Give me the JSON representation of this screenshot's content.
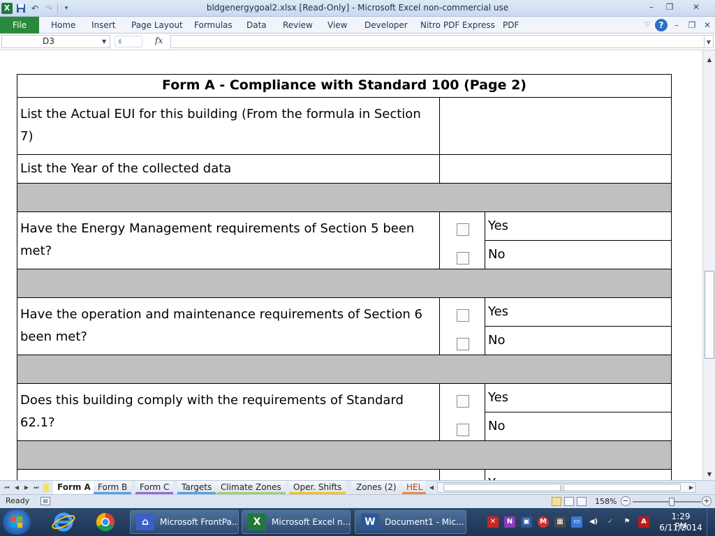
{
  "window": {
    "title": "bldgenergygoal2.xlsx  [Read-Only]  -  Microsoft Excel non-commercial use",
    "logo": "X",
    "controls": [
      "–",
      "❐",
      "✕"
    ]
  },
  "quick_access": {
    "icons": [
      "save-icon",
      "undo-icon",
      "redo-icon",
      "customize-icon"
    ]
  },
  "ribbon": {
    "file_tab": "File",
    "tabs": [
      "Home",
      "Insert",
      "Page Layout",
      "Formulas",
      "Data",
      "Review",
      "View",
      "Developer",
      "Nitro PDF Express",
      "PDF"
    ]
  },
  "formula_bar": {
    "name_box": "D3",
    "fx": "fx",
    "value": ""
  },
  "form": {
    "title": "Form A - Compliance with Standard 100  (Page 2)",
    "rows": [
      {
        "question": "List the Actual EUI for this building (From the formula in Section 7)"
      },
      {
        "question": "List the Year of the collected data"
      },
      {
        "question": "Have the Energy Management requirements of Section 5 been met?",
        "yes": "Yes",
        "no": "No"
      },
      {
        "question": "Have the operation and maintenance requirements of Section 6 been met?",
        "yes": "Yes",
        "no": "No"
      },
      {
        "question": "Does this building comply with the requirements of Standard 62.1?",
        "yes": "Yes",
        "no": "No"
      },
      {
        "yes": "Y"
      }
    ]
  },
  "sheet_tabs": [
    {
      "label": "Form A",
      "color": "#ffffff",
      "active": true
    },
    {
      "label": "Form B",
      "color": "#4fa3e8"
    },
    {
      "label": "Form C",
      "color": "#9b6ad6"
    },
    {
      "label": "Targets",
      "color": "#4fa3e8"
    },
    {
      "label": "Climate Zones",
      "color": "#a7cf6b"
    },
    {
      "label": "Oper. Shifts",
      "color": "#f5c518"
    },
    {
      "label": "Zones (2)",
      "color": "#e6e6e6"
    },
    {
      "label": "HEL",
      "color": "#f28a3c"
    }
  ],
  "status_bar": {
    "status": "Ready",
    "zoom": "158%",
    "zoom_out": "−",
    "zoom_in": "+"
  },
  "taskbar": {
    "apps": [
      {
        "label": "Microsoft FrontPa...",
        "icon": "frontpage-icon",
        "glyph": "⌂",
        "color": "#3a5fc8"
      },
      {
        "label": "Microsoft Excel n...",
        "icon": "excel-icon",
        "glyph": "X",
        "color": "#1f7a3a"
      },
      {
        "label": "Document1 - Mic...",
        "icon": "word-icon",
        "glyph": "W",
        "color": "#2b5797"
      }
    ],
    "time": "1:29 PM",
    "date": "6/11/2014"
  }
}
